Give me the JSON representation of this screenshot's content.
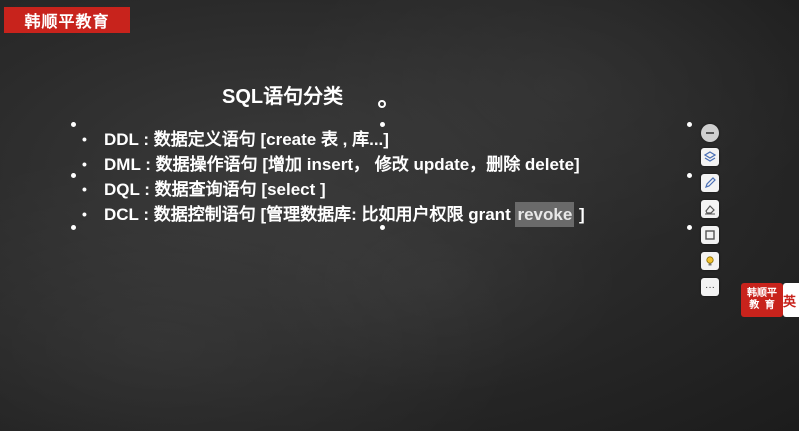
{
  "brand": {
    "label": "韩顺平教育"
  },
  "slide": {
    "title": "SQL语句分类",
    "bullets": [
      {
        "text": "DDL : 数据定义语句  [create 表 , 库...]"
      },
      {
        "text": "DML : 数据操作语句 [增加 insert， 修改 update，删除 delete]"
      },
      {
        "text": "DQL : 数据查询语句 [select ]"
      },
      {
        "text": "DCL : 数据控制语句 [管理数据库: 比如用户权限 grant ",
        "highlight": "revoke",
        "suffix": " ]"
      }
    ]
  },
  "toolbar": {
    "items": [
      "minus-icon",
      "layers-icon",
      "pen-icon",
      "eraser-icon",
      "rectangle-icon",
      "bulb-icon",
      "more-icon"
    ],
    "more_label": "···"
  },
  "logo_badge": {
    "line1": "韩顺平",
    "line2": "教  育"
  },
  "language": {
    "label": "英"
  }
}
